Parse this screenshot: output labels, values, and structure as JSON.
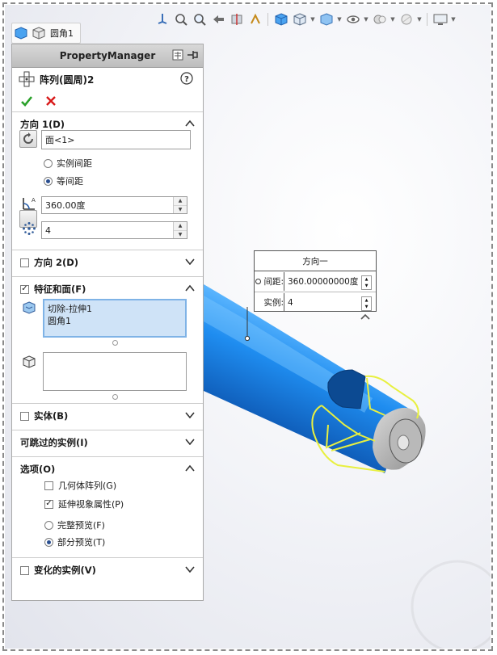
{
  "breadcrumb": {
    "label": "圆角1"
  },
  "property_manager": {
    "header_title": "PropertyManager",
    "feature_name": "阵列(圆周)2",
    "direction1": {
      "title": "方向 1(D)",
      "axis_value": "面<1>",
      "radio_instance_spacing": "实例间距",
      "radio_equal_spacing": "等间距",
      "angle_value": "360.00度",
      "count_value": "4"
    },
    "direction2": {
      "title": "方向 2(D)"
    },
    "features_faces": {
      "title": "特征和面(F)",
      "items": [
        "切除-拉伸1",
        "圆角1"
      ]
    },
    "bodies": {
      "title": "实体(B)"
    },
    "skip_instances": {
      "title": "可跳过的实例(I)"
    },
    "options": {
      "title": "选项(O)",
      "geometry_pattern": "几何体阵列(G)",
      "propagate_visual": "延伸视象属性(P)",
      "full_preview": "完整预览(F)",
      "partial_preview": "部分预览(T)"
    },
    "varying_instances": {
      "title": "变化的实例(V)"
    }
  },
  "callout": {
    "title": "方向一",
    "spacing_label": "间距:",
    "spacing_value": "360.00000000度",
    "instances_label": "实例:",
    "instances_value": "4"
  },
  "colors": {
    "part_blue": "#1f8df0",
    "edge_yellow": "#e8f040",
    "ok_green": "#2aa12a",
    "cancel_red": "#d81818"
  }
}
